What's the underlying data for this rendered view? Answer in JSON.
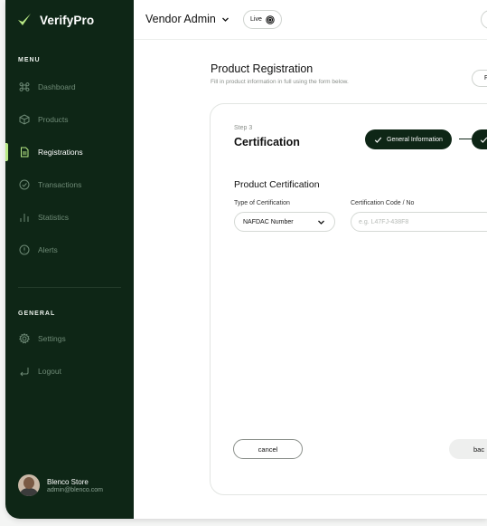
{
  "app": {
    "name": "VerifyPro",
    "brand_color": "#0e2616",
    "accent_color": "#b8e986"
  },
  "sidebar": {
    "menu_heading": "MENU",
    "items": [
      {
        "label": "Dashboard",
        "icon": "command-icon"
      },
      {
        "label": "Products",
        "icon": "box-icon"
      },
      {
        "label": "Registrations",
        "icon": "document-icon",
        "active": true
      },
      {
        "label": "Transactions",
        "icon": "check-circle-icon"
      },
      {
        "label": "Statistics",
        "icon": "bar-chart-icon"
      },
      {
        "label": "Alerts",
        "icon": "alert-icon"
      }
    ],
    "general_heading": "GENERAL",
    "general_items": [
      {
        "label": "Settings",
        "icon": "gear-icon"
      },
      {
        "label": "Logout",
        "icon": "logout-icon"
      }
    ],
    "user": {
      "name": "Blenco Store",
      "email": "admin@blenco.com"
    }
  },
  "topbar": {
    "title": "Vendor Admin",
    "status": "Live"
  },
  "page": {
    "title": "Product Registration",
    "subtitle": "Fill in product information in full using the form below.",
    "top_button": "F"
  },
  "form": {
    "step_label": "Step 3",
    "step_title": "Certification",
    "steps_done": [
      "General Information"
    ],
    "section_title": "Product Certification",
    "cert_type_label": "Type of Certification",
    "cert_type_value": "NAFDAC Number",
    "cert_code_label": "Certification Code / No",
    "cert_code_placeholder": "e.g. L47FJ-438F8",
    "cancel_label": "cancel",
    "back_label": "bac"
  }
}
